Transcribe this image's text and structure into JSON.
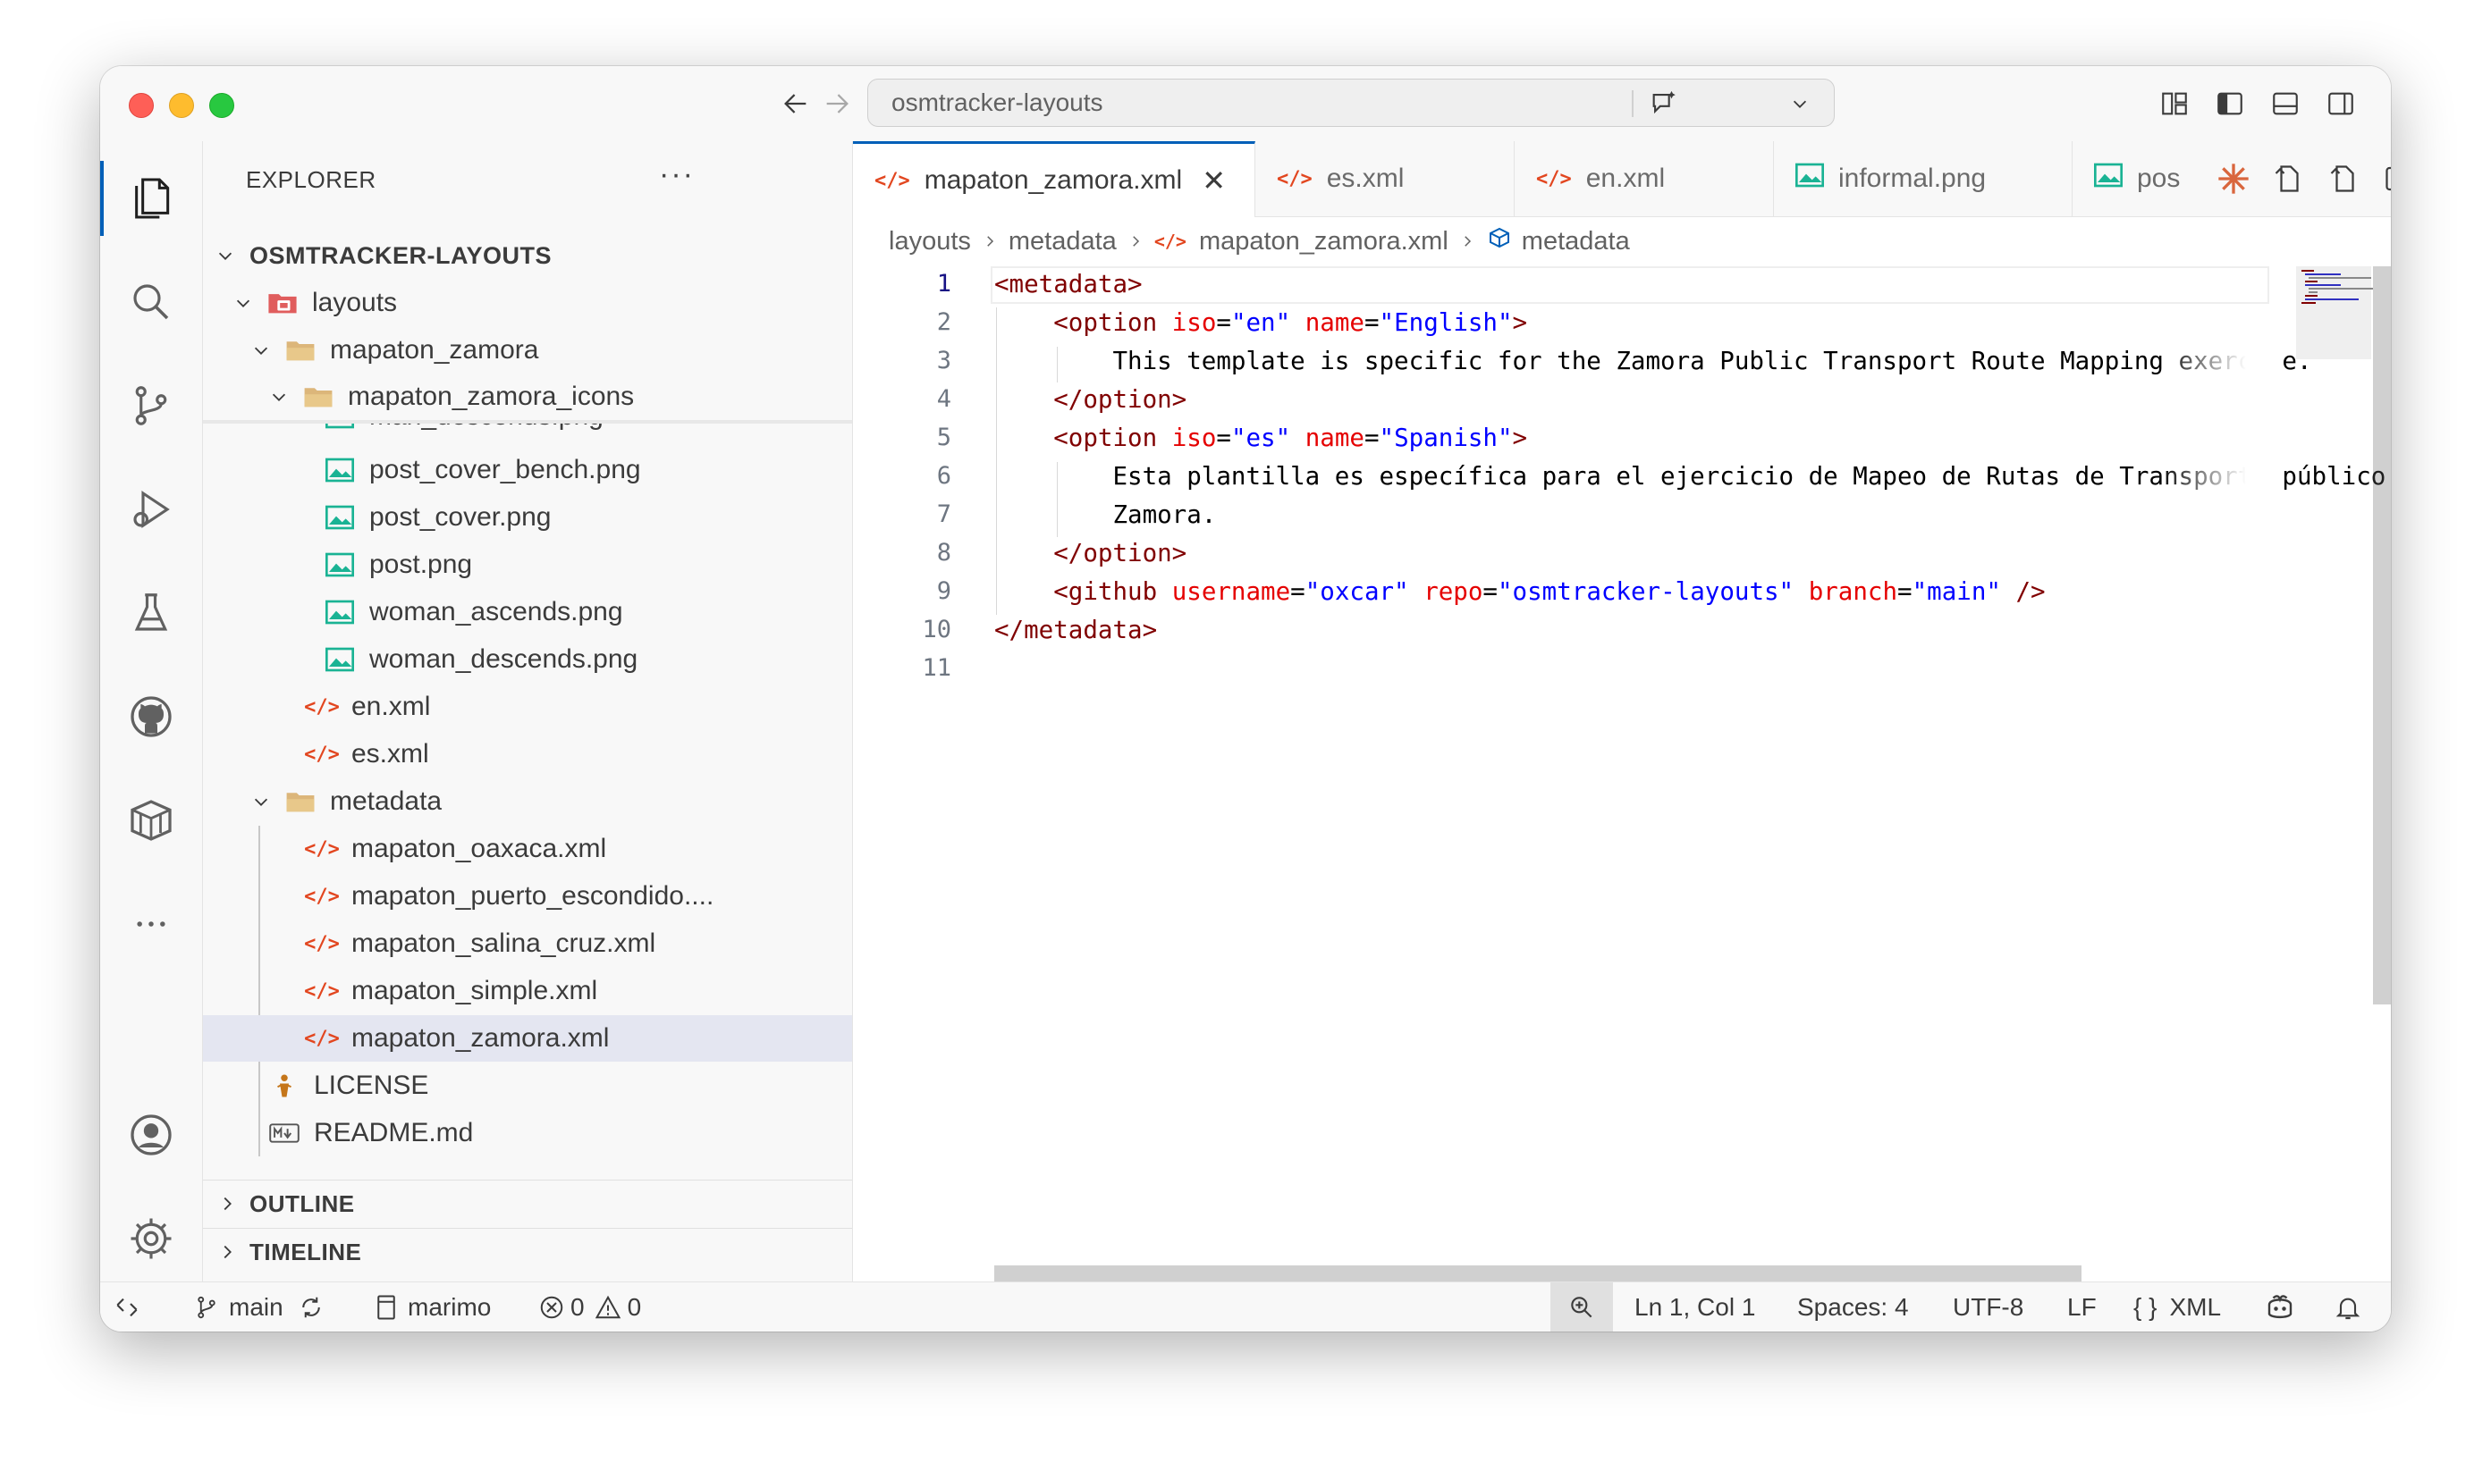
{
  "window": {
    "command_center": {
      "text": "osmtracker-layouts"
    }
  },
  "activity_bar": {
    "items": [
      "explorer",
      "search",
      "source-control",
      "run-and-debug",
      "testing",
      "github",
      "remote-explorer",
      "more",
      "accounts",
      "manage"
    ]
  },
  "sidebar": {
    "title": "EXPLORER",
    "more": "···",
    "root": "OSMTRACKER-LAYOUTS",
    "tree": {
      "layouts": "layouts",
      "mapaton_zamora": "mapaton_zamora",
      "icons_folder": "mapaton_zamora_icons",
      "partial_file": "man_descends.png",
      "files": [
        "post_cover_bench.png",
        "post_cover.png",
        "post.png",
        "woman_ascends.png",
        "woman_descends.png"
      ],
      "xml_files": [
        "en.xml",
        "es.xml"
      ],
      "metadata_folder": "metadata",
      "metadata_files": [
        "mapaton_oaxaca.xml",
        "mapaton_puerto_escondido....",
        "mapaton_salina_cruz.xml",
        "mapaton_simple.xml",
        "mapaton_zamora.xml"
      ],
      "license": "LICENSE",
      "readme": "README.md"
    },
    "outline": "OUTLINE",
    "timeline": "TIMELINE"
  },
  "tabs": [
    {
      "label": "mapaton_zamora.xml",
      "type": "xml",
      "active": true
    },
    {
      "label": "es.xml",
      "type": "xml"
    },
    {
      "label": "en.xml",
      "type": "xml"
    },
    {
      "label": "informal.png",
      "type": "image"
    },
    {
      "label": "pos",
      "type": "image"
    }
  ],
  "breadcrumbs": [
    "layouts",
    "metadata",
    "mapaton_zamora.xml",
    "metadata"
  ],
  "editor": {
    "line_numbers": [
      "1",
      "2",
      "3",
      "4",
      "5",
      "6",
      "7",
      "8",
      "9",
      "10",
      "11"
    ],
    "lines": {
      "l1_tag": "<metadata>",
      "l2_open": "<option",
      "l2_a1": "iso",
      "l2_v1": "\"en\"",
      "l2_a2": "name",
      "l2_v2": "\"English\"",
      "l2_close": ">",
      "l3_text": "This template is specific for the Zamora Public Transport Route Mapping exercise.",
      "l4_tag": "</option>",
      "l5_open": "<option",
      "l5_a1": "iso",
      "l5_v1": "\"es\"",
      "l5_a2": "name",
      "l5_v2": "\"Spanish\"",
      "l5_close": ">",
      "l6_text": "Esta plantilla es específica para el ejercicio de Mapeo de Rutas de Transporte público",
      "l7_text": "Zamora.",
      "l8_tag": "</option>",
      "l9_open": "<github",
      "l9_a1": "username",
      "l9_v1": "\"oxcar\"",
      "l9_a2": "repo",
      "l9_v2": "\"osmtracker-layouts\"",
      "l9_a3": "branch",
      "l9_v3": "\"main\"",
      "l9_close": "/>",
      "l10_tag": "</metadata>"
    }
  },
  "status_bar": {
    "branch": "main",
    "kernel": "marimo",
    "errors": "0",
    "warnings": "0",
    "position": "Ln 1, Col 1",
    "spaces": "Spaces: 4",
    "encoding": "UTF-8",
    "eol": "LF",
    "language_braces": "{ }",
    "language": "XML"
  },
  "colors": {
    "accent": "#005fb8",
    "xml_icon": "#e2461f",
    "image_icon": "#1ab394",
    "folder_icon": "#dcb67a"
  }
}
